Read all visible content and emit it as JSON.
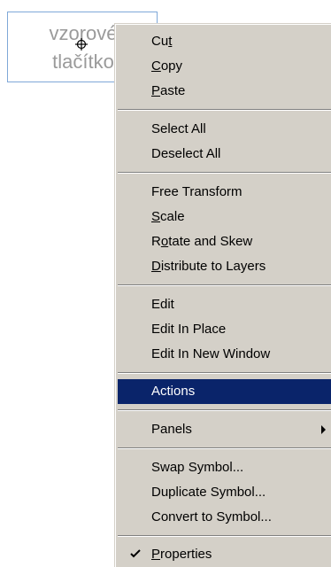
{
  "canvas": {
    "sample_button_text": "vzorové\ntlačítko"
  },
  "context_menu": {
    "groups": [
      [
        {
          "label_pre": "Cu",
          "label_key": "t",
          "label_post": ""
        },
        {
          "label_pre": "",
          "label_key": "C",
          "label_post": "opy"
        },
        {
          "label_pre": "",
          "label_key": "P",
          "label_post": "aste"
        }
      ],
      [
        {
          "label": "Select All"
        },
        {
          "label": "Deselect All"
        }
      ],
      [
        {
          "label": "Free Transform"
        },
        {
          "label_pre": "",
          "label_key": "S",
          "label_post": "cale"
        },
        {
          "label_pre": "R",
          "label_key": "o",
          "label_post": "tate and Skew"
        },
        {
          "label_pre": "",
          "label_key": "D",
          "label_post": "istribute to Layers"
        }
      ],
      [
        {
          "label": "Edit"
        },
        {
          "label": "Edit In Place"
        },
        {
          "label": "Edit In New Window"
        }
      ],
      [
        {
          "label": "Actions",
          "highlighted": true
        }
      ],
      [
        {
          "label": "Panels",
          "submenu": true
        }
      ],
      [
        {
          "label": "Swap Symbol..."
        },
        {
          "label": "Duplicate Symbol..."
        },
        {
          "label": "Convert to Symbol..."
        }
      ],
      [
        {
          "label_pre": "",
          "label_key": "P",
          "label_post": "roperties",
          "checked": true
        }
      ]
    ],
    "highlight_color": "#0a246a",
    "background_color": "#d4d0c8"
  }
}
